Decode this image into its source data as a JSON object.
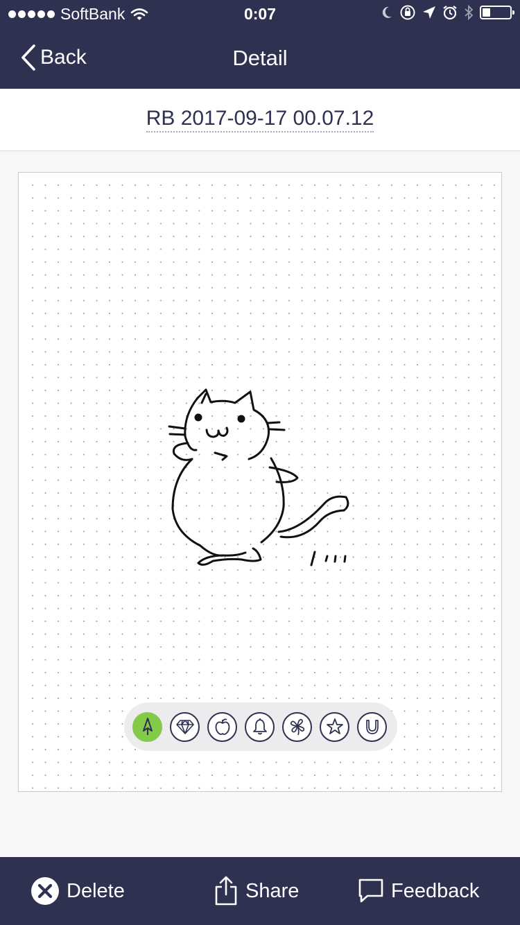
{
  "status_bar": {
    "carrier": "SoftBank",
    "time": "0:07",
    "battery_level": 0.3
  },
  "nav": {
    "back_label": "Back",
    "title": "Detail"
  },
  "document": {
    "title": "RB 2017-09-17 00.07.12"
  },
  "tags": [
    {
      "icon": "pen-icon",
      "active": true
    },
    {
      "icon": "diamond-icon",
      "active": false
    },
    {
      "icon": "apple-icon",
      "active": false
    },
    {
      "icon": "bell-icon",
      "active": false
    },
    {
      "icon": "clover-icon",
      "active": false
    },
    {
      "icon": "star-icon",
      "active": false
    },
    {
      "icon": "horseshoe-icon",
      "active": false
    }
  ],
  "toolbar": {
    "delete_label": "Delete",
    "share_label": "Share",
    "feedback_label": "Feedback"
  },
  "colors": {
    "bar": "#2f3150",
    "accent": "#83c94a"
  }
}
